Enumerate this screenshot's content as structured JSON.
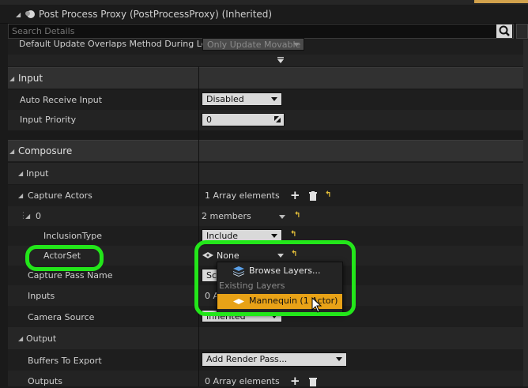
{
  "window": {
    "title": "Post Process Proxy (PostProcessProxy) (Inherited)"
  },
  "search": {
    "placeholder": "Search Details"
  },
  "partial_row": {
    "label": "Default Update Overlaps Method During Leve",
    "value": "Only Update Movable"
  },
  "sections": {
    "input": {
      "label": "Input"
    },
    "composure": {
      "label": "Composure"
    },
    "composure_input": {
      "label": "Input"
    },
    "output": {
      "label": "Output"
    }
  },
  "properties": {
    "auto_receive_input": {
      "label": "Auto Receive Input",
      "value": "Disabled"
    },
    "input_priority": {
      "label": "Input Priority",
      "value": "0"
    },
    "capture_actors": {
      "label": "Capture Actors",
      "value": "1 Array elements"
    },
    "element_0": {
      "label": "0",
      "value": "2 members"
    },
    "inclusion_type": {
      "label": "InclusionType",
      "value": "Include"
    },
    "actor_set": {
      "label": "ActorSet",
      "value": "None"
    },
    "capture_pass_name": {
      "label": "Capture Pass Name",
      "value": "Sc"
    },
    "inputs": {
      "label": "Inputs",
      "value": "0 A"
    },
    "camera_source": {
      "label": "Camera Source",
      "value": "Inherited"
    },
    "buffers_to_export": {
      "label": "Buffers To Export",
      "value": "Add Render Pass..."
    },
    "outputs": {
      "label": "Outputs",
      "value": "0 Array elements"
    }
  },
  "dropdown_menu": {
    "browse_label": "Browse Layers...",
    "section_header": "Existing Layers",
    "items": [
      {
        "label": "Mannequin (1 Actor)"
      }
    ]
  },
  "colors": {
    "highlight_callout": "#23e61a",
    "selected_item": "#e8a217",
    "reset_arrow": "#e8c23a"
  },
  "icons": {
    "search": "search-icon",
    "add": "plus-icon",
    "delete": "trash-icon",
    "reset": "reset-to-default-icon",
    "layers": "layers-icon"
  }
}
